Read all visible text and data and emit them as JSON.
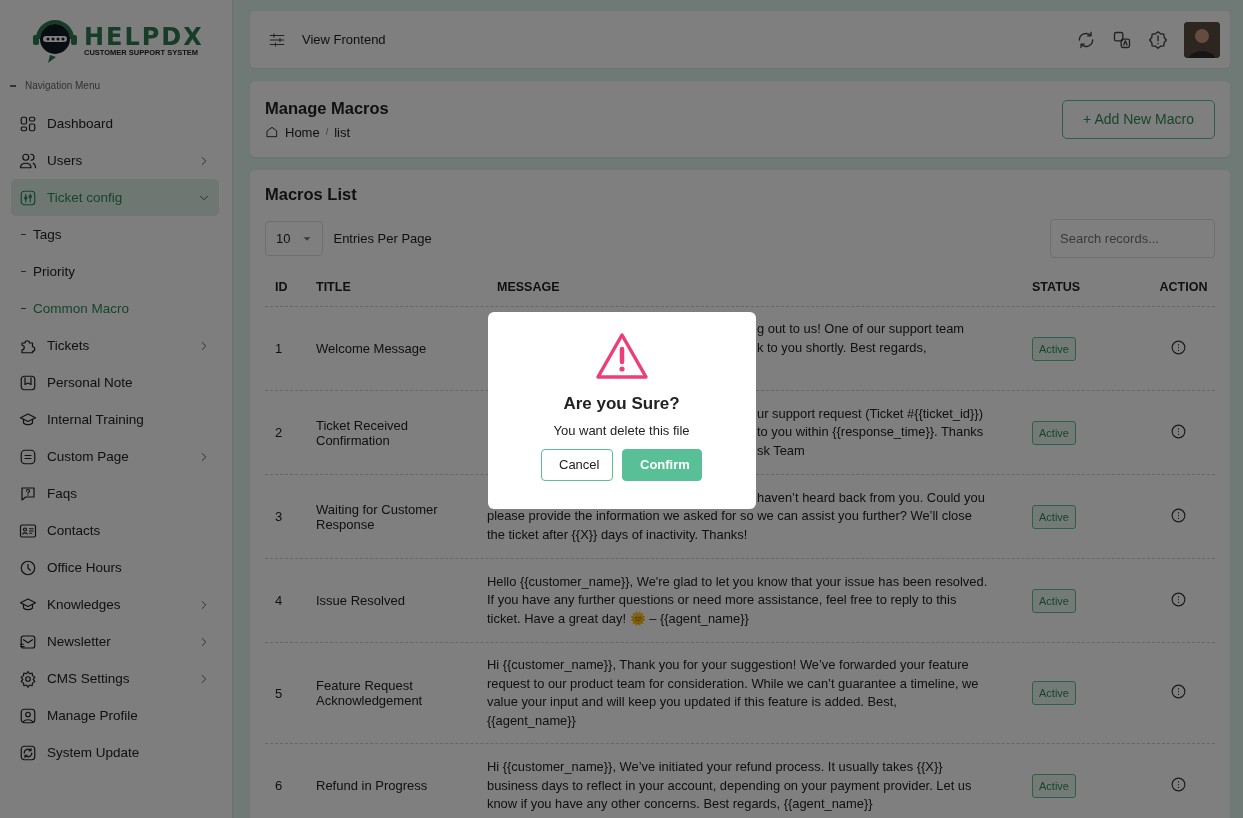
{
  "logo": {
    "name": "HELPDX",
    "tagline": "CUSTOMER SUPPORT SYSTEM"
  },
  "sidebar": {
    "section_label": "Navigation Menu",
    "items": [
      {
        "label": "Dashboard",
        "selected": false,
        "has_submenu": false
      },
      {
        "label": "Users",
        "selected": false,
        "has_submenu": true,
        "expanded": false
      },
      {
        "label": "Ticket config",
        "selected": true,
        "has_submenu": true,
        "expanded": true,
        "children": [
          {
            "label": "Tags",
            "selected": false
          },
          {
            "label": "Priority",
            "selected": false
          },
          {
            "label": "Common Macro",
            "selected": true
          }
        ]
      },
      {
        "label": "Tickets",
        "selected": false,
        "has_submenu": true,
        "expanded": false
      },
      {
        "label": "Personal Note",
        "selected": false,
        "has_submenu": false
      },
      {
        "label": "Internal Training",
        "selected": false,
        "has_submenu": false
      },
      {
        "label": "Custom Page",
        "selected": false,
        "has_submenu": true,
        "expanded": false
      },
      {
        "label": "Faqs",
        "selected": false,
        "has_submenu": false
      },
      {
        "label": "Contacts",
        "selected": false,
        "has_submenu": false
      },
      {
        "label": "Office Hours",
        "selected": false,
        "has_submenu": false
      },
      {
        "label": "Knowledges",
        "selected": false,
        "has_submenu": true,
        "expanded": false
      },
      {
        "label": "Newsletter",
        "selected": false,
        "has_submenu": true,
        "expanded": false
      },
      {
        "label": "CMS Settings",
        "selected": false,
        "has_submenu": true,
        "expanded": false
      },
      {
        "label": "Manage Profile",
        "selected": false,
        "has_submenu": false
      },
      {
        "label": "System Update",
        "selected": false,
        "has_submenu": false
      }
    ]
  },
  "topbar": {
    "link": "View Frontend"
  },
  "page_header": {
    "title": "Manage Macros",
    "breadcrumb": [
      "Home",
      "list"
    ],
    "breadcrumb_separator": "/",
    "add_button": "+ Add New Macro"
  },
  "macros_list": {
    "title": "Macros List",
    "entries_per_page": "10",
    "entries_label": "Entries Per Page",
    "search": {
      "placeholder": "Search records..."
    },
    "columns": [
      "ID",
      "TITLE",
      "MESSAGE",
      "STATUS",
      "ACTION"
    ],
    "rows": [
      {
        "id": "1",
        "title": "Welcome Message",
        "message": [
          {
            "kind": "covered",
            "text": "g out to us! One of our support team"
          },
          {
            "kind": "covered",
            "text": "k to you shortly. Best regards,"
          },
          {
            "kind": "hidden"
          }
        ],
        "status": "Active"
      },
      {
        "id": "2",
        "title": "Ticket Received Confirmation",
        "message": [
          {
            "kind": "covered",
            "text": "ur support request (Ticket #{{ticket_id}})"
          },
          {
            "kind": "covered",
            "text": "to you within {{response_time}}. Thanks"
          },
          {
            "kind": "covered",
            "text": "sk Team"
          }
        ],
        "status": "Active"
      },
      {
        "id": "3",
        "title": "Waiting for Customer Response",
        "message": [
          {
            "kind": "covered",
            "text": "haven’t heard back from you. Could you"
          },
          {
            "kind": "line",
            "text": "please provide the information we asked for so we can assist you further? We’ll close"
          },
          {
            "kind": "line",
            "text": "the ticket after {{X}} days of inactivity. Thanks!"
          }
        ],
        "status": "Active"
      },
      {
        "id": "4",
        "title": "Issue Resolved",
        "message": [
          {
            "kind": "line",
            "text": "Hello {{customer_name}}, We're glad to let you know that your issue has been resolved."
          },
          {
            "kind": "line",
            "text": "If you have any further questions or need more assistance, feel free to reply to this"
          },
          {
            "kind": "line",
            "text": "ticket. Have a great day! 🌞 – {{agent_name}}"
          }
        ],
        "status": "Active"
      },
      {
        "id": "5",
        "title": "Feature Request Acknowledgement",
        "message": [
          {
            "kind": "line",
            "text": "Hi {{customer_name}}, Thank you for your suggestion! We’ve forwarded your feature"
          },
          {
            "kind": "line",
            "text": "request to our product team for consideration. While we can’t guarantee a timeline, we"
          },
          {
            "kind": "line",
            "text": "value your input and will keep you updated if this feature is added. Best,"
          },
          {
            "kind": "line",
            "text": "{{agent_name}}"
          }
        ],
        "status": "Active"
      },
      {
        "id": "6",
        "title": "Refund in Progress",
        "message": [
          {
            "kind": "line",
            "text": "Hi {{customer_name}}, We’ve initiated your refund process. It usually takes {{X}}"
          },
          {
            "kind": "line",
            "text": "business days to reflect in your account, depending on your payment provider. Let us"
          },
          {
            "kind": "line",
            "text": "know if you have any other concerns. Best regards, {{agent_name}}"
          }
        ],
        "status": "Active"
      }
    ]
  },
  "dialog": {
    "open": true,
    "title": "Are you Sure?",
    "text": "You want delete this file",
    "buttons": [
      "Cancel",
      "Confirm"
    ]
  }
}
